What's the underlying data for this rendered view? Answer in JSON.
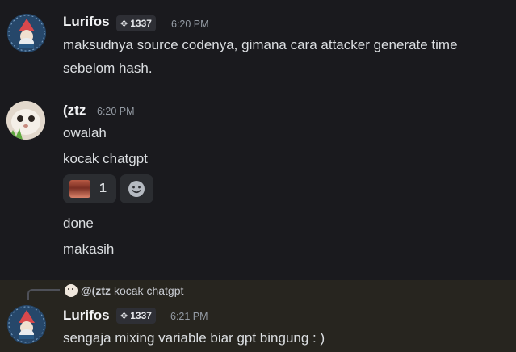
{
  "messages": {
    "m1": {
      "author": "Lurifos",
      "tag": "1337",
      "time": "6:20 PM",
      "lines": [
        "maksudnya source codenya, gimana cara attacker generate time",
        "sebelom hash."
      ]
    },
    "m2": {
      "author": "(ztz",
      "time": "6:20 PM",
      "lines": [
        "owalah",
        "kocak chatgpt"
      ],
      "reaction": {
        "count": "1"
      },
      "lines_after": [
        "done",
        "makasih"
      ]
    },
    "m3": {
      "reply_author": "@(ztz",
      "reply_text": "kocak chatgpt",
      "author": "Lurifos",
      "tag": "1337",
      "time": "6:21 PM",
      "lines": [
        "sengaja mixing variable biar gpt bingung : )"
      ]
    }
  },
  "icons": {
    "tag_icon": "clan-tag-icon",
    "add_reaction": "add-reaction-smiley-icon"
  },
  "colors": {
    "background": "#1a1a1e",
    "reply_highlight": "#27251f",
    "username": "#f2f3f5",
    "timestamp": "#949ba4"
  }
}
